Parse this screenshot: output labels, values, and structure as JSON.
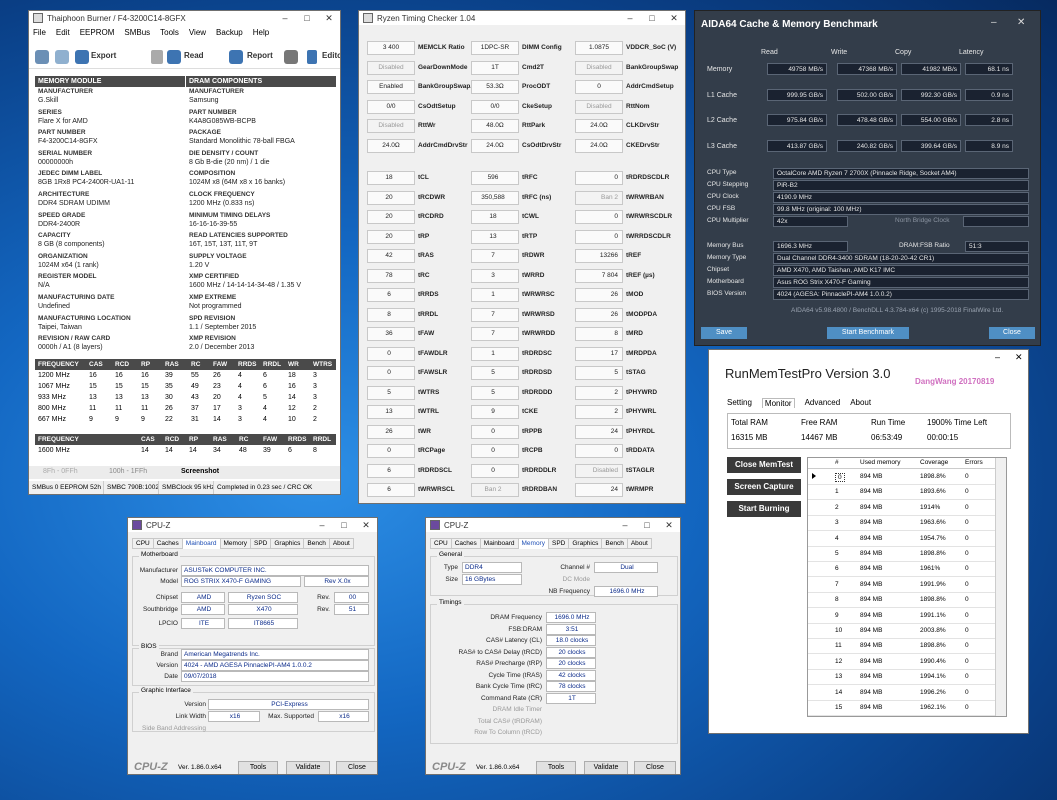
{
  "thaiphoon": {
    "title": "Thaiphoon Burner / F4-3200C14-8GFX",
    "menu": [
      "File",
      "Edit",
      "EEPROM",
      "SMBus",
      "Tools",
      "View",
      "Backup",
      "Help"
    ],
    "toolbar": [
      "Export",
      "Read",
      "Report",
      "Editor"
    ],
    "hdr_left": "MEMORY MODULE",
    "hdr_right": "DRAM COMPONENTS",
    "rows": [
      [
        "MANUFACTURER",
        "G.Skill",
        "MANUFACTURER",
        "Samsung"
      ],
      [
        "SERIES",
        "Flare X for AMD",
        "PART NUMBER",
        "K4A8G085WB-BCPB"
      ],
      [
        "PART NUMBER",
        "F4-3200C14-8GFX",
        "PACKAGE",
        "Standard Monolithic 78-ball FBGA"
      ],
      [
        "SERIAL NUMBER",
        "00000000h",
        "DIE DENSITY / COUNT",
        "8 Gb B-die (20 nm) / 1 die"
      ],
      [
        "JEDEC DIMM LABEL",
        "8GB 1Rx8 PC4-2400R-UA1-11",
        "COMPOSITION",
        "1024M x8 (64M x8 x 16 banks)"
      ],
      [
        "ARCHITECTURE",
        "DDR4 SDRAM UDIMM",
        "CLOCK FREQUENCY",
        "1200 MHz (0.833 ns)"
      ],
      [
        "SPEED GRADE",
        "DDR4-2400R",
        "MINIMUM TIMING DELAYS",
        "16-16-16-39-55"
      ],
      [
        "CAPACITY",
        "8 GB (8 components)",
        "READ LATENCIES SUPPORTED",
        "16T, 15T, 13T, 11T, 9T"
      ],
      [
        "ORGANIZATION",
        "1024M x64 (1 rank)",
        "SUPPLY VOLTAGE",
        "1.20 V"
      ],
      [
        "REGISTER MODEL",
        "N/A",
        "XMP CERTIFIED",
        "1600 MHz / 14-14-14-34-48 / 1.35 V"
      ],
      [
        "MANUFACTURING DATE",
        "Undefined",
        "XMP EXTREME",
        "Not programmed"
      ],
      [
        "MANUFACTURING LOCATION",
        "Taipei, Taiwan",
        "SPD REVISION",
        "1.1 / September 2015"
      ],
      [
        "REVISION / RAW CARD",
        "0000h / A1 (8 layers)",
        "XMP REVISION",
        "2.0 / December 2013"
      ]
    ],
    "freq_head": [
      "FREQUENCY",
      "CAS",
      "RCD",
      "RP",
      "RAS",
      "RC",
      "FAW",
      "RRDS",
      "RRDL",
      "WR",
      "WTRS"
    ],
    "freq_rows": [
      [
        "1200 MHz",
        "16",
        "16",
        "16",
        "39",
        "55",
        "26",
        "4",
        "6",
        "18",
        "3"
      ],
      [
        "1067 MHz",
        "15",
        "15",
        "15",
        "35",
        "49",
        "23",
        "4",
        "6",
        "16",
        "3"
      ],
      [
        "933 MHz",
        "13",
        "13",
        "13",
        "30",
        "43",
        "20",
        "4",
        "5",
        "14",
        "3"
      ],
      [
        "800 MHz",
        "11",
        "11",
        "11",
        "26",
        "37",
        "17",
        "3",
        "4",
        "12",
        "2"
      ],
      [
        "667 MHz",
        "9",
        "9",
        "9",
        "22",
        "31",
        "14",
        "3",
        "4",
        "10",
        "2"
      ]
    ],
    "xmp_head": [
      "FREQUENCY",
      "CAS",
      "RCD",
      "RP",
      "RAS",
      "RC",
      "FAW",
      "RRDS",
      "RRDL"
    ],
    "xmp_row": [
      "1600 MHz",
      "14",
      "14",
      "14",
      "34",
      "48",
      "39",
      "6",
      "8"
    ],
    "bottom_tabs": [
      "8Fh - 0FFh",
      "100h - 1FFh",
      "Screenshot"
    ],
    "status": [
      "SMBus 0 EEPROM 52h",
      "SMBC 790B:1002",
      "SMBClock 95 kHz",
      "Completed in 0.23 sec / CRC OK"
    ]
  },
  "rtc": {
    "title": "Ryzen Timing Checker 1.04",
    "top": [
      [
        "3 400",
        "MEMCLK Ratio",
        "1DPC-SR",
        "DIMM Config",
        "1.0875",
        "VDDCR_SoC (V)"
      ],
      [
        "Disabled",
        "GearDownMode",
        "1T",
        "Cmd2T",
        "Disabled",
        "BankGroupSwap"
      ],
      [
        "Enabled",
        "BankGroupSwapAlt",
        "53.3Ω",
        "ProcODT",
        "0",
        "AddrCmdSetup"
      ],
      [
        "0/0",
        "CsOdtSetup",
        "0/0",
        "CkeSetup",
        "Disabled",
        "RttNom"
      ],
      [
        "Disabled",
        "RttWr",
        "48.0Ω",
        "RttPark",
        "24.0Ω",
        "CLKDrvStr"
      ],
      [
        "24.0Ω",
        "AddrCmdDrvStr",
        "24.0Ω",
        "CsOdtDrvStr",
        "24.0Ω",
        "CKEDrvStr"
      ]
    ],
    "rows": [
      [
        "18",
        "tCL",
        "596",
        "tRFC",
        "0",
        "tRDRDSCDLR"
      ],
      [
        "20",
        "tRCDWR",
        "350,588",
        "tRFC (ns)",
        "Ban 2",
        "tWRWRBAN"
      ],
      [
        "20",
        "tRCDRD",
        "18",
        "tCWL",
        "0",
        "tWRWRSCDLR"
      ],
      [
        "20",
        "tRP",
        "13",
        "tRTP",
        "0",
        "tWRRDSCDLR"
      ],
      [
        "42",
        "tRAS",
        "7",
        "tRDWR",
        "13266",
        "tREF"
      ],
      [
        "78",
        "tRC",
        "3",
        "tWRRD",
        "7 804",
        "tREF (µs)"
      ],
      [
        "6",
        "tRRDS",
        "1",
        "tWRWRSC",
        "26",
        "tMOD"
      ],
      [
        "8",
        "tRRDL",
        "7",
        "tWRWRSD",
        "26",
        "tMODPDA"
      ],
      [
        "36",
        "tFAW",
        "7",
        "tWRWRDD",
        "8",
        "tMRD"
      ],
      [
        "0",
        "tFAWDLR",
        "1",
        "tRDRDSC",
        "17",
        "tMRDPDA"
      ],
      [
        "0",
        "tFAWSLR",
        "5",
        "tRDRDSD",
        "5",
        "tSTAG"
      ],
      [
        "5",
        "tWTRS",
        "5",
        "tRDRDDD",
        "2",
        "tPHYWRD"
      ],
      [
        "13",
        "tWTRL",
        "9",
        "tCKE",
        "2",
        "tPHYWRL"
      ],
      [
        "26",
        "tWR",
        "0",
        "tRPPB",
        "24",
        "tPHYRDL"
      ],
      [
        "0",
        "tRCPage",
        "0",
        "tRCPB",
        "0",
        "tRDDATA"
      ],
      [
        "6",
        "tRDRDSCL",
        "0",
        "tRDRDDLR",
        "Disabled",
        "tSTAGLR"
      ],
      [
        "6",
        "tWRWRSCL",
        "Ban 2",
        "tRDRDBAN",
        "24",
        "tWRMPR"
      ]
    ]
  },
  "aida": {
    "title": "AIDA64 Cache & Memory Benchmark",
    "cols": [
      "Read",
      "Write",
      "Copy",
      "Latency"
    ],
    "rows": [
      [
        "Memory",
        "49758 MB/s",
        "47368 MB/s",
        "41982 MB/s",
        "68.1 ns"
      ],
      [
        "L1 Cache",
        "999.95 GB/s",
        "502.00 GB/s",
        "992.30 GB/s",
        "0.9 ns"
      ],
      [
        "L2 Cache",
        "975.84 GB/s",
        "478.48 GB/s",
        "554.00 GB/s",
        "2.8 ns"
      ],
      [
        "L3 Cache",
        "413.87 GB/s",
        "240.82 GB/s",
        "399.64 GB/s",
        "8.9 ns"
      ]
    ],
    "cpu_type": "OctalCore AMD Ryzen 7 2700X  (Pinnacle Ridge, Socket AM4)",
    "cpu_stepping": "PiR-B2",
    "cpu_clock": "4190.9 MHz",
    "cpu_fsb": "99.8 MHz  (original: 100 MHz)",
    "cpu_mult": "42x",
    "nb_clock": "North Bridge Clock",
    "mem_bus": "1696.3 MHz",
    "dram_fsb_label": "DRAM:FSB Ratio",
    "dram_fsb": "51:3",
    "mem_type": "Dual Channel DDR4-3400 SDRAM  (18-20-20-42 CR1)",
    "chipset": "AMD X470, AMD Taishan, AMD K17 IMC",
    "motherboard": "Asus ROG Strix X470-F Gaming",
    "bios": "4024  (AGESA: PinnaclePI-AM4 1.0.0.2)",
    "labels": [
      "CPU Type",
      "CPU Stepping",
      "CPU Clock",
      "CPU FSB",
      "CPU Multiplier",
      "Memory Bus",
      "Memory Type",
      "Chipset",
      "Motherboard",
      "BIOS Version"
    ],
    "footer": "AIDA64 v5.98.4800 / BenchDLL 4.3.784-x64  (c) 1995-2018 FinalWire Ltd.",
    "buttons": [
      "Save",
      "Start Benchmark",
      "Close"
    ]
  },
  "rmt": {
    "title": "RunMemTestPro Version 3.0",
    "author": "DangWang  20170819",
    "tabs": [
      "Setting",
      "Monitor",
      "Advanced",
      "About"
    ],
    "stat_labels": [
      "Total RAM",
      "Free RAM",
      "Run Time",
      "1900% Time Left"
    ],
    "stat_vals": [
      "16315 MB",
      "14467 MB",
      "06:53:49",
      "00:00:15"
    ],
    "buttons": [
      "Close MemTest",
      "Screen Capture",
      "Start Burning"
    ],
    "grid_head": [
      "#",
      "Used memory",
      "Coverage",
      "Errors"
    ],
    "grid": [
      [
        "0",
        "894 MB",
        "1898.8%",
        "0"
      ],
      [
        "1",
        "894 MB",
        "1893.6%",
        "0"
      ],
      [
        "2",
        "894 MB",
        "1914%",
        "0"
      ],
      [
        "3",
        "894 MB",
        "1963.6%",
        "0"
      ],
      [
        "4",
        "894 MB",
        "1954.7%",
        "0"
      ],
      [
        "5",
        "894 MB",
        "1898.8%",
        "0"
      ],
      [
        "6",
        "894 MB",
        "1961%",
        "0"
      ],
      [
        "7",
        "894 MB",
        "1991.9%",
        "0"
      ],
      [
        "8",
        "894 MB",
        "1898.8%",
        "0"
      ],
      [
        "9",
        "894 MB",
        "1991.1%",
        "0"
      ],
      [
        "10",
        "894 MB",
        "2003.8%",
        "0"
      ],
      [
        "11",
        "894 MB",
        "1898.8%",
        "0"
      ],
      [
        "12",
        "894 MB",
        "1990.4%",
        "0"
      ],
      [
        "13",
        "894 MB",
        "1994.1%",
        "0"
      ],
      [
        "14",
        "894 MB",
        "1996.2%",
        "0"
      ],
      [
        "15",
        "894 MB",
        "1962.1%",
        "0"
      ]
    ]
  },
  "cpuz1": {
    "title": "CPU-Z",
    "tabs": [
      "CPU",
      "Caches",
      "Mainboard",
      "Memory",
      "SPD",
      "Graphics",
      "Bench",
      "About"
    ],
    "mb_cap": "Motherboard",
    "manufacturer": "ASUSTeK COMPUTER INC.",
    "model": "ROG STRIX X470-F GAMING",
    "model_rev": "Rev X.0x",
    "chipset_a": "AMD",
    "chipset_b": "Ryzen SOC",
    "chipset_rev": "00",
    "south_a": "AMD",
    "south_b": "X470",
    "south_rev": "51",
    "lpcio_a": "ITE",
    "lpcio_b": "IT8665",
    "bios_cap": "BIOS",
    "brand": "American Megatrends Inc.",
    "version": "4024 - AMD AGESA PinnaclePI-AM4 1.0.0.2",
    "date": "09/07/2018",
    "gi_cap": "Graphic Interface",
    "gi_version": "PCI-Express",
    "link_width": "x16",
    "max_supported": "x16",
    "labels": [
      "Manufacturer",
      "Model",
      "Chipset",
      "Southbridge",
      "LPCIO",
      "Brand",
      "Version",
      "Date",
      "Version",
      "Link Width",
      "Side Band Addressing",
      "Rev.",
      "Rev.",
      "Max. Supported"
    ],
    "logo": "CPU-Z",
    "ver": "Ver. 1.86.0.x64",
    "btns": [
      "Tools",
      "Validate",
      "Close"
    ]
  },
  "cpuz2": {
    "title": "CPU-Z",
    "tabs": [
      "CPU",
      "Caches",
      "Mainboard",
      "Memory",
      "SPD",
      "Graphics",
      "Bench",
      "About"
    ],
    "gen_cap": "General",
    "type": "DDR4",
    "size": "16 GBytes",
    "channel": "Dual",
    "dc_mode": "DC Mode",
    "nb_freq": "1696.0 MHz",
    "timing_cap": "Timings",
    "labels": [
      "Type",
      "Size",
      "Channel #",
      "NB Frequency"
    ],
    "timings": [
      [
        "DRAM Frequency",
        "1696.0 MHz"
      ],
      [
        "FSB:DRAM",
        "3:51"
      ],
      [
        "CAS# Latency (CL)",
        "18.0 clocks"
      ],
      [
        "RAS# to CAS# Delay (tRCD)",
        "20 clocks"
      ],
      [
        "RAS# Precharge (tRP)",
        "20 clocks"
      ],
      [
        "Cycle Time (tRAS)",
        "42 clocks"
      ],
      [
        "Bank Cycle Time (tRC)",
        "78 clocks"
      ],
      [
        "Command Rate (CR)",
        "1T"
      ],
      [
        "DRAM Idle Timer",
        ""
      ],
      [
        "Total CAS# (tRDRAM)",
        ""
      ],
      [
        "Row To Column (tRCD)",
        ""
      ]
    ],
    "logo": "CPU-Z",
    "ver": "Ver. 1.86.0.x64",
    "btns": [
      "Tools",
      "Validate",
      "Close"
    ]
  }
}
